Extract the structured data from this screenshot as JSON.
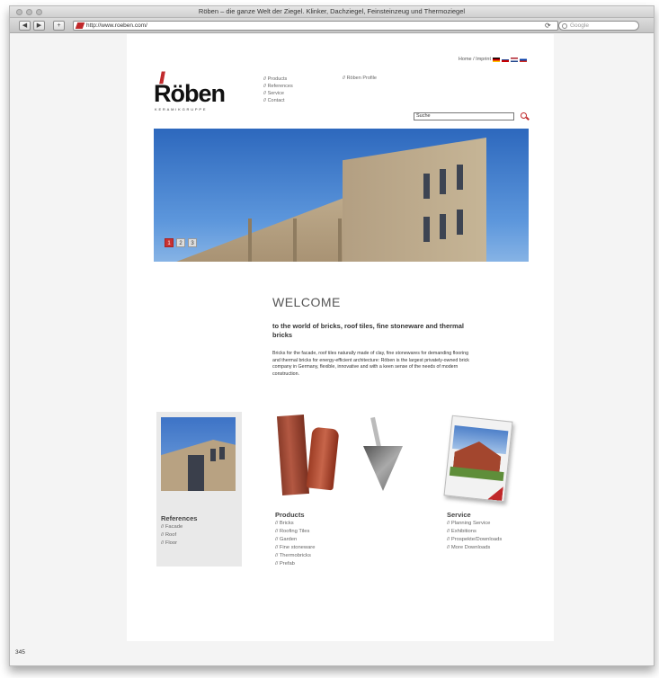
{
  "browser": {
    "window_title": "Röben – die ganze Welt der Ziegel. Klinker, Dachziegel, Feinsteinzeug und Thermoziegel",
    "url": "http://www.roeben.com/",
    "search_placeholder": "Google",
    "status_text": "345",
    "back": "◀",
    "forward": "▶",
    "add": "+",
    "reload": "⟳"
  },
  "header": {
    "lang_links": "Home / Imprint",
    "flags": [
      "de",
      "en",
      "nl",
      "ru"
    ],
    "logo_word": "Röben",
    "logo_slashes": "//",
    "logo_sub": "KERAMIKGRUPPE",
    "nav_col1": [
      "// Products",
      "// References",
      "// Service",
      "// Contact"
    ],
    "nav_col2": [
      "// Röben Profile"
    ],
    "search_value": "Suche"
  },
  "slider": {
    "pages": [
      "1",
      "2",
      "3"
    ],
    "active_index": 0
  },
  "welcome": {
    "title": "WELCOME",
    "subtitle": "to the world of bricks, roof tiles, fine stoneware and thermal bricks",
    "body": "Bricks for the facade, roof tiles naturally made of clay, fine stonewares for demanding flooring and thermal bricks for energy-efficient architecture: Röben is the largest privately-owned brick company in Germany, flexible, innovative and with a keen sense of the needs of modern construction."
  },
  "references": {
    "title": "References",
    "items": [
      "// Facade",
      "// Roof",
      "// Floor"
    ]
  },
  "products": {
    "title": "Products",
    "items": [
      "// Bricks",
      "// Roofing Tiles",
      "// Garden",
      "// Fine stoneware",
      "// Thermobricks",
      "// Prefab"
    ]
  },
  "service": {
    "title": "Service",
    "items": [
      "// Planning Service",
      "// Exhibitions",
      "// Prospekte/Downloads",
      "// More Downloads"
    ]
  },
  "colors": {
    "brand_red": "#c0282a",
    "sky_blue": "#2d68bd"
  }
}
